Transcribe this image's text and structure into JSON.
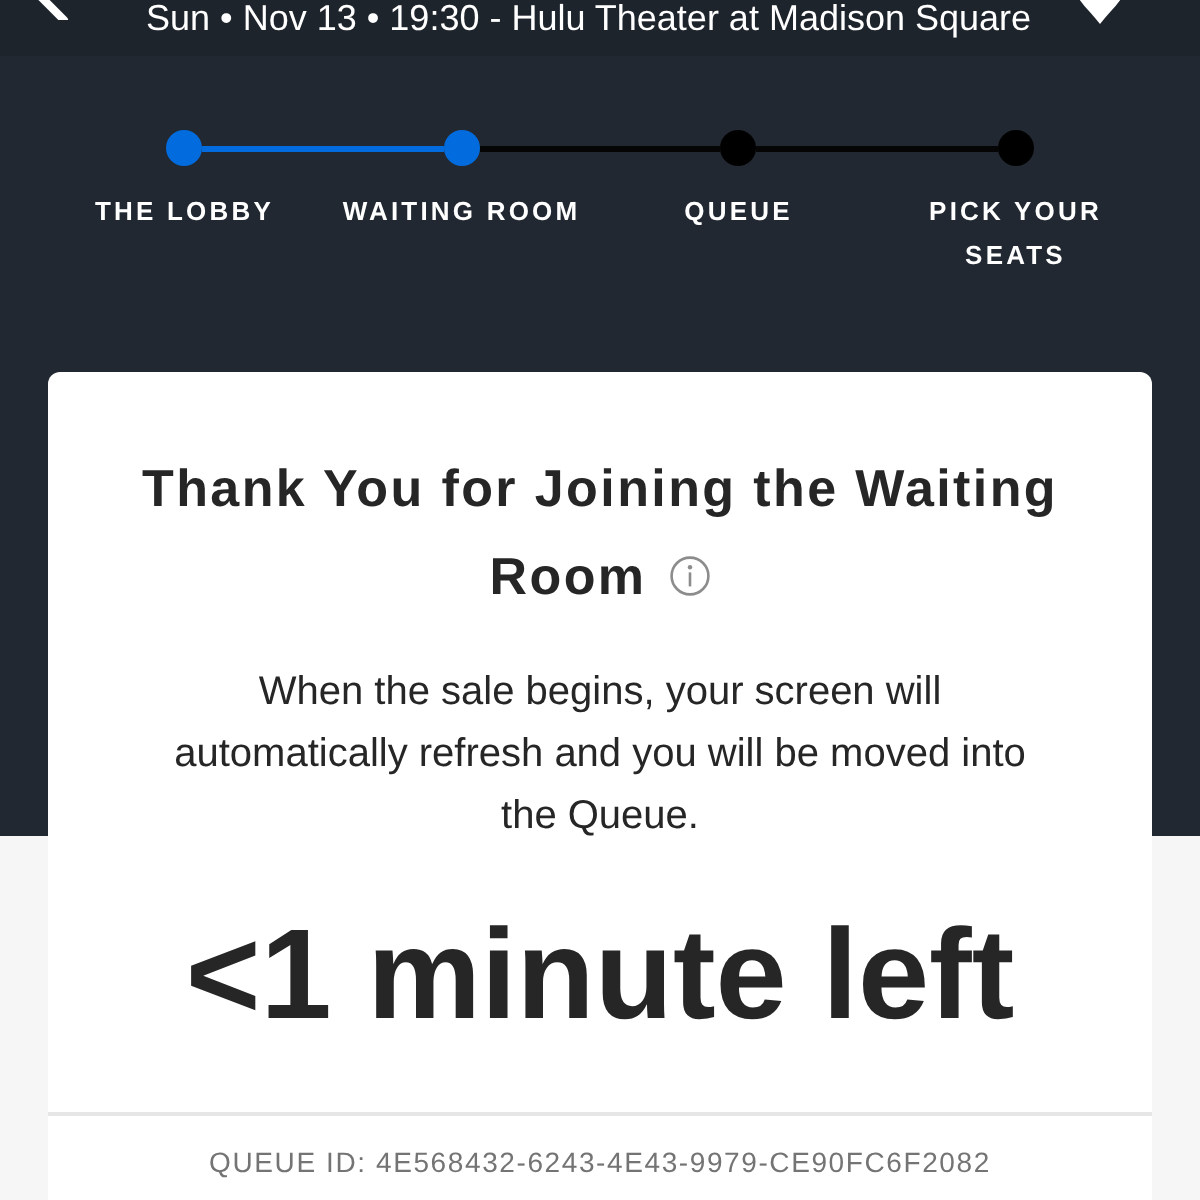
{
  "header": {
    "event_info": "Sun • Nov 13 • 19:30 - Hulu Theater at Madison Square"
  },
  "steps": [
    {
      "label": "THE LOBBY",
      "reached": true
    },
    {
      "label": "WAITING ROOM",
      "reached": true
    },
    {
      "label": "QUEUE",
      "reached": false
    },
    {
      "label": "PICK YOUR SEATS",
      "reached": false
    }
  ],
  "card": {
    "title_lines": [
      "Thank You for Joining the Waiting",
      "Room"
    ],
    "message": "When the sale begins, your screen will automatically refresh and you will be moved into the Queue.",
    "countdown": "<1 minute left",
    "queue_id": "QUEUE ID: 4E568432-6243-4E43-9979-CE90FC6F2082"
  }
}
